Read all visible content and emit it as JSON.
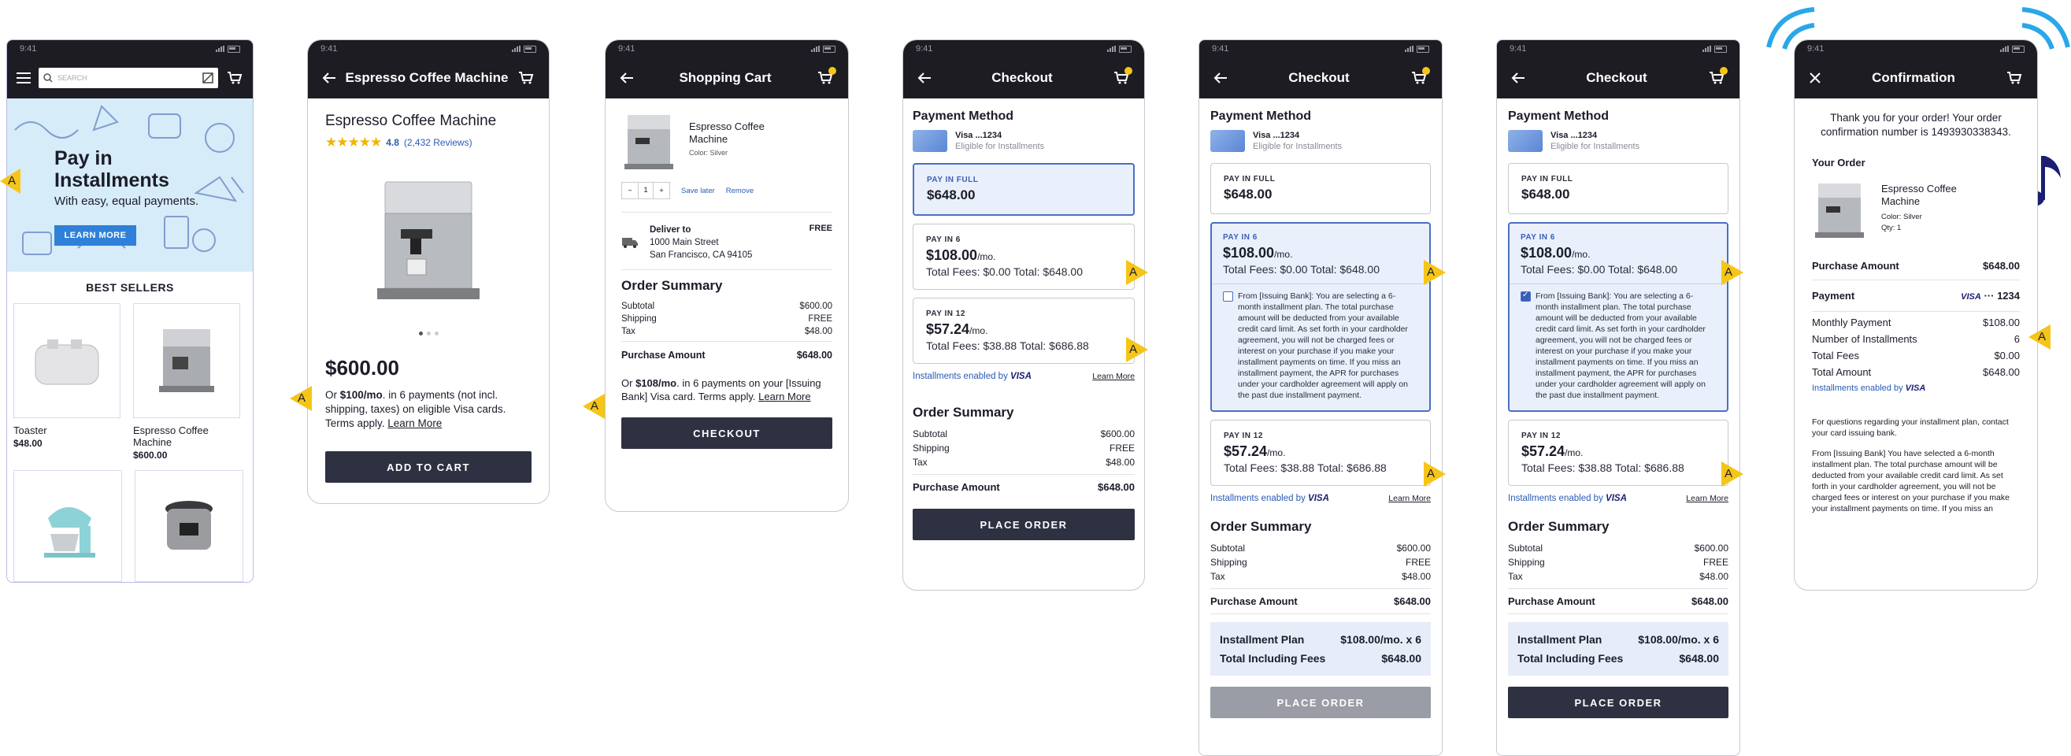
{
  "common": {
    "time": "9:41",
    "visa": "VISA",
    "visa_dots": "··· 1234",
    "enabled_by": "Installments enabled by",
    "learn_more": "Learn More",
    "marker": "A"
  },
  "s1": {
    "search_placeholder": "SEARCH",
    "banner_title": "Pay in Installments",
    "banner_sub": "With easy, equal payments.",
    "learn_btn": "LEARN MORE",
    "best_sellers": "BEST SELLERS",
    "products": [
      {
        "name": "Toaster",
        "price": "$48.00"
      },
      {
        "name": "Espresso Coffee Machine",
        "price": "$600.00"
      }
    ]
  },
  "s2": {
    "title": "Espresso Coffee Machine",
    "product_name": "Espresso Coffee Machine",
    "rating": "4.8",
    "reviews": "(2,432 Reviews)",
    "price": "$600.00",
    "msg_pre": "Or ",
    "msg_bold": "$100/mo",
    "msg_post": ". in 6 payments (not incl. shipping, taxes) on eligible Visa cards. Terms apply. ",
    "learn": "Learn More",
    "cta": "ADD TO CART"
  },
  "s3": {
    "title": "Shopping Cart",
    "item": "Espresso Coffee Machine",
    "color": "Color: Silver",
    "qty": "1",
    "save_later": "Save later",
    "remove": "Remove",
    "deliver_to": "Deliver to",
    "addr1": "1000 Main Street",
    "addr2": "San Francisco, CA 94105",
    "free": "FREE",
    "summary": "Order Summary",
    "rows": [
      {
        "label": "Subtotal",
        "value": "$600.00"
      },
      {
        "label": "Shipping",
        "value": "FREE"
      },
      {
        "label": "Tax",
        "value": "$48.00"
      }
    ],
    "purchase_label": "Purchase Amount",
    "purchase_value": "$648.00",
    "msg_pre": "Or ",
    "msg_bold": "$108/mo",
    "msg_post": ". in 6 payments on your [Issuing Bank] Visa card. Terms apply. ",
    "learn": "Learn More",
    "cta": "CHECKOUT"
  },
  "checkout": {
    "title": "Checkout",
    "payment_method": "Payment Method",
    "card": "Visa ...1234",
    "eligible": "Eligible for Installments",
    "full_tag": "PAY IN FULL",
    "full_amt": "$648.00",
    "p6_tag": "PAY IN 6",
    "p6_amt": "$108.00",
    "p6_fees": "Total Fees: $0.00  Total: $648.00",
    "p12_tag": "PAY IN 12",
    "p12_amt": "$57.24",
    "p12_fees": "Total Fees: $38.88  Total: $686.88",
    "mo": "/mo.",
    "summary": "Order Summary",
    "rows": [
      {
        "label": "Subtotal",
        "value": "$600.00"
      },
      {
        "label": "Shipping",
        "value": "FREE"
      },
      {
        "label": "Tax",
        "value": "$48.00"
      }
    ],
    "purchase_label": "Purchase Amount",
    "purchase_value": "$648.00",
    "cta": "PLACE ORDER",
    "terms": "From [Issuing Bank]: You are selecting a 6-month installment plan. The total purchase amount will be deducted from your available credit card limit. As set forth in your cardholder agreement, you will not be charged fees or interest on your purchase if you make your installment payments on time. If you miss an installment payment, the APR for purchases under your cardholder agreement will apply on the past due installment payment.",
    "plan_label": "Installment Plan",
    "plan_value": "$108.00/mo. x 6",
    "total_fees_label": "Total Including Fees",
    "total_fees_value": "$648.00"
  },
  "s7": {
    "title": "Confirmation",
    "thanks": "Thank you for your order! Your order confirmation number is 1493930338343.",
    "your_order": "Your Order",
    "item": "Espresso Coffee Machine",
    "color": "Color: Silver",
    "qty": "Qty: 1",
    "rows": [
      {
        "label": "Purchase Amount",
        "value": "$648.00"
      }
    ],
    "payment": "Payment",
    "rows2": [
      {
        "label": "Monthly Payment",
        "value": "$108.00"
      },
      {
        "label": "Number of Installments",
        "value": "6"
      },
      {
        "label": "Total Fees",
        "value": "$0.00"
      },
      {
        "label": "Total Amount",
        "value": "$648.00"
      }
    ],
    "questions": "For questions regarding your installment plan, contact your card issuing bank.",
    "terms": "From [Issuing Bank] You have selected a 6-month installment plan. The total purchase amount will be deducted from your available credit card limit. As set forth in your cardholder agreement, you will not be charged fees or interest on your purchase if you make your installment payments on time. If you miss an installment payment, the APR for purchases under your"
  }
}
